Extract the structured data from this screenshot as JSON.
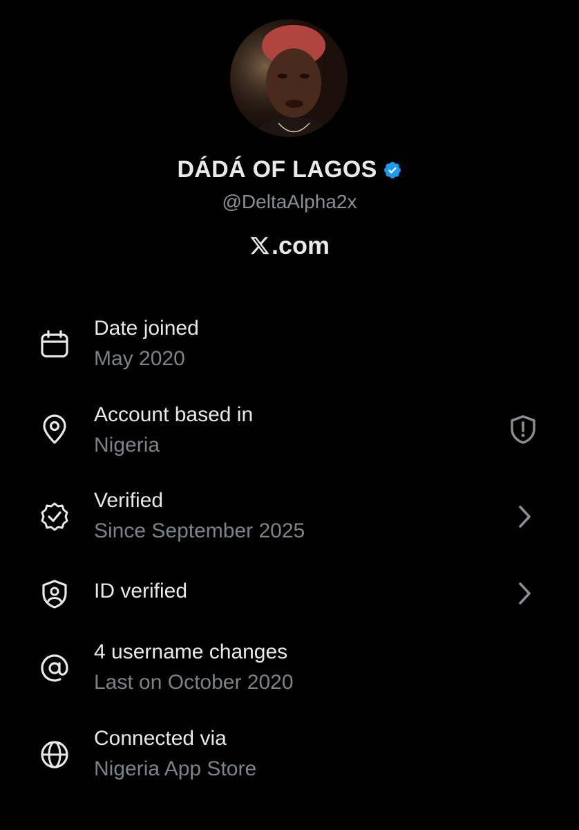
{
  "profile": {
    "display_name": "DÁDÁ OF LAGOS",
    "handle": "@DeltaAlpha2x",
    "site": ".com",
    "verified_badge_color": "#1d9bf0"
  },
  "rows": [
    {
      "title": "Date joined",
      "subtitle": "May 2020",
      "icon": "calendar-icon"
    },
    {
      "title": "Account based in",
      "subtitle": "Nigeria",
      "icon": "location-pin-icon",
      "trailing": "shield-alert-icon"
    },
    {
      "title": "Verified",
      "subtitle": "Since September 2025",
      "icon": "verified-check-icon",
      "trailing": "chevron-right-icon"
    },
    {
      "title": "ID verified",
      "icon": "id-shield-icon",
      "trailing": "chevron-right-icon"
    },
    {
      "title": "4 username changes",
      "subtitle": "Last on October 2020",
      "icon": "at-sign-icon"
    },
    {
      "title": "Connected via",
      "subtitle": "Nigeria App Store",
      "icon": "globe-icon"
    }
  ],
  "colors": {
    "background": "#000000",
    "primary_text": "#e7e9ea",
    "secondary_text": "#7e8287",
    "icon": "#e7e9ea",
    "trailing_icon": "#8b8f94"
  }
}
